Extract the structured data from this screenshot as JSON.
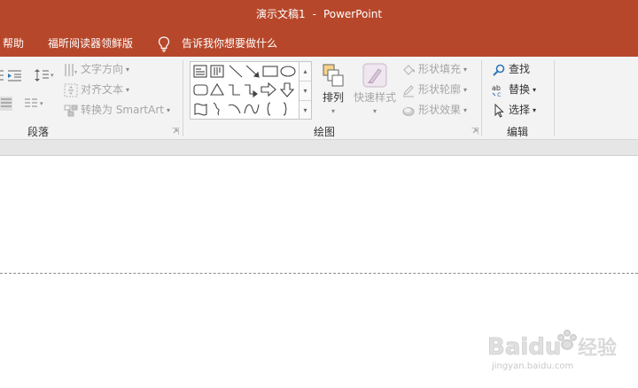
{
  "window": {
    "doc_title": "演示文稿1",
    "separator": "-",
    "app_name": "PowerPoint"
  },
  "menu": {
    "items": [
      "帮助",
      "福昕阅读器领鲜版"
    ],
    "tell_me": "告诉我你想要做什么"
  },
  "ribbon": {
    "paragraph": {
      "label": "段落",
      "text_direction": "文字方向",
      "align_text": "对齐文本",
      "convert_smartart": "转换为 SmartArt"
    },
    "drawing": {
      "label": "绘图",
      "arrange": "排列",
      "quick_styles": "快速样式",
      "shape_fill": "形状填充",
      "shape_outline": "形状轮廓",
      "shape_effects": "形状效果"
    },
    "editing": {
      "label": "编辑",
      "find": "查找",
      "replace": "替换",
      "select": "选择",
      "replace_icon_text": "ab"
    }
  },
  "watermark": {
    "brand": "Baidu",
    "brand_cn": "经验",
    "url": "jingyan.baidu.com"
  },
  "colors": {
    "accent": "#b7472a",
    "ribbon_bg": "#f3f3f3",
    "disabled_text": "#a6a6a6"
  }
}
